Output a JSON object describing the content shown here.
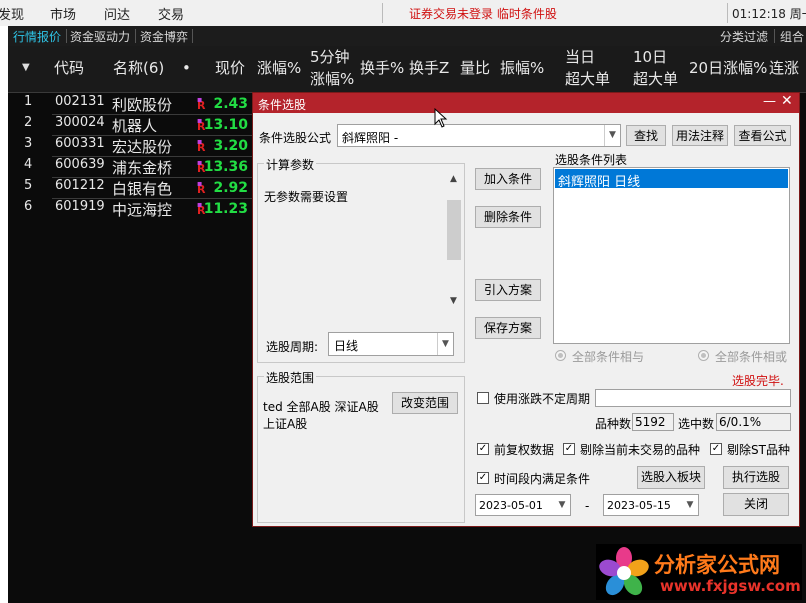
{
  "menubar": {
    "items": [
      "发现",
      "市场",
      "问达",
      "交易"
    ],
    "status": "证券交易未登录  临时条件股",
    "clock": "01:12:18 周一"
  },
  "tabs": [
    "行情报价",
    "资金驱动力",
    "资金博弈"
  ],
  "tabs_right": [
    "分类过滤",
    "组合"
  ],
  "table": {
    "headers": {
      "code": "代码",
      "name": "名称(6)",
      "dot": "•",
      "price": "现价",
      "chg": "涨幅%",
      "m5_line1": "5分钟",
      "m5_line2": "涨幅%",
      "turnover": "换手%",
      "turnoverz": "换手Z",
      "volratio": "量比",
      "amp": "振幅%",
      "big_line1": "当日",
      "big_line2": "超大单",
      "d10_line1": "10日",
      "d10_line2": "超大单",
      "chg20": "20日涨幅%",
      "streak": "连涨"
    },
    "rows": [
      {
        "no": "1",
        "code": "002131",
        "name": "利欧股份",
        "price": "2.43"
      },
      {
        "no": "2",
        "code": "300024",
        "name": "机器人",
        "price": "13.10"
      },
      {
        "no": "3",
        "code": "600331",
        "name": "宏达股份",
        "price": "3.20"
      },
      {
        "no": "4",
        "code": "600639",
        "name": "浦东金桥",
        "price": "13.36"
      },
      {
        "no": "5",
        "code": "601212",
        "name": "白银有色",
        "price": "2.92"
      },
      {
        "no": "6",
        "code": "601919",
        "name": "中远海控",
        "price": "11.23"
      }
    ],
    "row_marker": "R"
  },
  "dialog": {
    "title": "条件选股",
    "formula_label": "条件选股公式",
    "formula_value": "斜辉照阳    -",
    "find_button": "查找",
    "usage_button": "用法注释",
    "view_formula_button": "查看公式",
    "params_group": "计算参数",
    "params_text": "无参数需要设置",
    "add_condition": "加入条件",
    "delete_condition": "删除条件",
    "import_scheme": "引入方案",
    "save_scheme": "保存方案",
    "conditions_list_label": "选股条件列表",
    "conditions_list": [
      "斜辉照阳  日线"
    ],
    "period_label": "选股周期:",
    "period_value": "日线",
    "radio_and": "全部条件相与",
    "radio_or": "全部条件相或",
    "done_status": "选股完毕.",
    "range_group": "选股范围",
    "range_text_line1": "ted 全部A股 深证A股",
    "range_text_line2": "上证A股",
    "change_range": "改变范围",
    "use_uncertain_period": "使用涨跌不定周期",
    "count_label": "品种数",
    "count_value": "5192",
    "selected_label": "选中数",
    "selected_value": "6/0.1%",
    "pre_adjust": "前复权数据",
    "remove_untraded": "剔除当前未交易的品种",
    "remove_st": "剔除ST品种",
    "within_period": "时间段内满足条件",
    "to_block": "选股入板块",
    "execute": "执行选股",
    "date_from": "2023-05-01",
    "date_sep": "-",
    "date_to": "2023-05-15",
    "close": "关闭"
  },
  "watermark": {
    "title": "分析家公式网",
    "url": "www.fxjgsw.com"
  },
  "colors": {
    "title_bar": "#b4232b",
    "price_green": "#22dd44",
    "selection_blue": "#0078d7",
    "status_red": "#d01010"
  }
}
